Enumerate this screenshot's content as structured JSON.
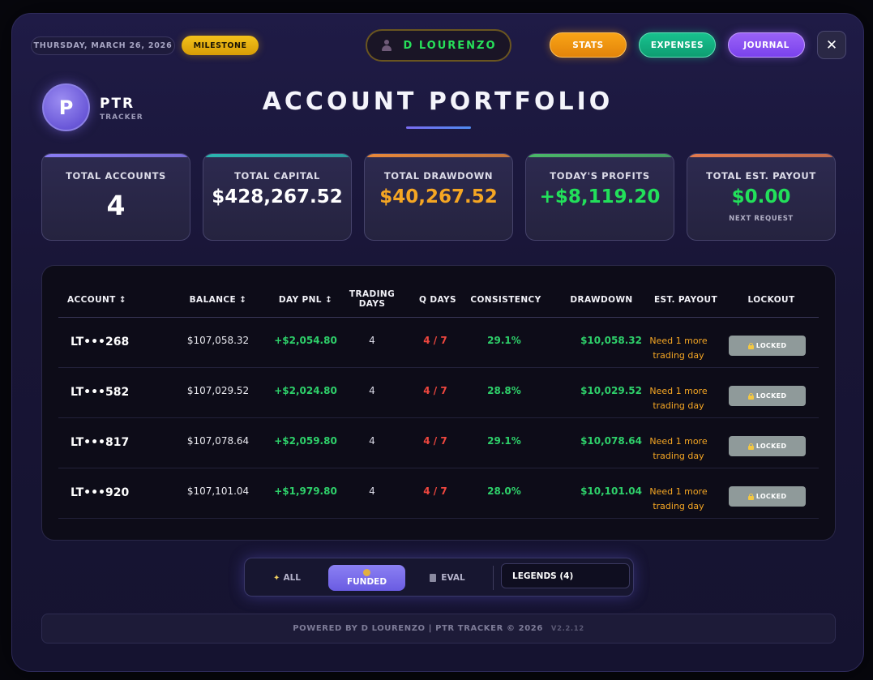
{
  "header": {
    "date": "THURSDAY, MARCH 26, 2026",
    "milestone": "MILESTONE",
    "user": "D LOURENZO",
    "nav": {
      "stats": "STATS",
      "expenses": "EXPENSES",
      "journal": "JOURNAL"
    },
    "close": "✕"
  },
  "logo": {
    "letter": "P",
    "name": "PTR",
    "sub": "TRACKER"
  },
  "title": "ACCOUNT PORTFOLIO",
  "stats": [
    {
      "label": "TOTAL ACCOUNTS",
      "value": "4",
      "color": "#ffffff",
      "bar": "#8a7cf5"
    },
    {
      "label": "TOTAL CAPITAL",
      "value": "$428,267.52",
      "color": "#ffffff",
      "bar": "#2bb5b0"
    },
    {
      "label": "TOTAL DRAWDOWN",
      "value": "$40,267.52",
      "color": "#f5a623",
      "bar": "#e8883a"
    },
    {
      "label": "TODAY'S PROFITS",
      "value": "+$8,119.20",
      "color": "#22e05a",
      "bar": "#4ab868"
    },
    {
      "label": "TOTAL EST. PAYOUT",
      "value": "$0.00",
      "sub": "NEXT REQUEST",
      "color": "#22e05a",
      "bar": "#e37a4e"
    }
  ],
  "table": {
    "columns": {
      "account": "ACCOUNT ↕",
      "balance": "BALANCE ↕",
      "pnl": "DAY PNL ↕",
      "trading_days_1": "TRADING",
      "trading_days_2": "DAYS",
      "q_days": "Q DAYS",
      "consistency": "CONSISTENCY",
      "drawdown": "DRAWDOWN",
      "payout": "EST. PAYOUT",
      "lockout": "LOCKOUT"
    },
    "rows": [
      {
        "account": "LT•••268",
        "balance": "$107,058.32",
        "pnl": "+$2,054.80",
        "days": "4",
        "q": "4 / 7",
        "consistency": "29.1%",
        "drawdown": "$10,058.32",
        "payout": "Need 1 more trading day",
        "lockout": "LOCKED"
      },
      {
        "account": "LT•••582",
        "balance": "$107,029.52",
        "pnl": "+$2,024.80",
        "days": "4",
        "q": "4 / 7",
        "consistency": "28.8%",
        "drawdown": "$10,029.52",
        "payout": "Need 1 more trading day",
        "lockout": "LOCKED"
      },
      {
        "account": "LT•••817",
        "balance": "$107,078.64",
        "pnl": "+$2,059.80",
        "days": "4",
        "q": "4 / 7",
        "consistency": "29.1%",
        "drawdown": "$10,078.64",
        "payout": "Need 1 more trading day",
        "lockout": "LOCKED"
      },
      {
        "account": "LT•••920",
        "balance": "$107,101.04",
        "pnl": "+$1,979.80",
        "days": "4",
        "q": "4 / 7",
        "consistency": "28.0%",
        "drawdown": "$10,101.04",
        "payout": "Need 1 more trading day",
        "lockout": "LOCKED"
      }
    ]
  },
  "filters": {
    "all": "ALL",
    "funded": "FUNDED",
    "eval": "EVAL",
    "select": "LEGENDS (4)"
  },
  "footer": {
    "text": "POWERED BY D LOURENZO | PTR TRACKER © 2026",
    "version": "V2.2.12"
  }
}
